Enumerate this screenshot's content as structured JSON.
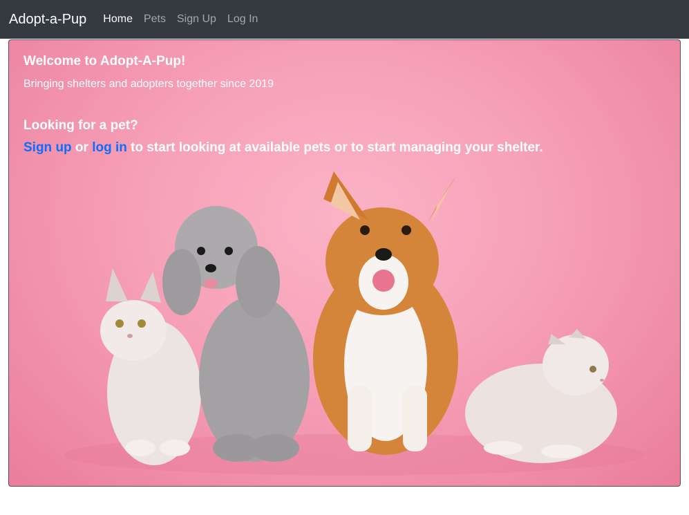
{
  "navbar": {
    "brand": "Adopt-a-Pup",
    "links": [
      {
        "label": "Home",
        "active": true
      },
      {
        "label": "Pets",
        "active": false
      },
      {
        "label": "Sign Up",
        "active": false
      },
      {
        "label": "Log In",
        "active": false
      }
    ],
    "colors": {
      "background": "#343a40",
      "active": "#ffffff",
      "inactive": "#a0a3a6"
    }
  },
  "hero": {
    "title": "Welcome to Adopt-A-Pup!",
    "subtitle": "Bringing shelters and adopters together since 2019",
    "question": "Looking for a pet?",
    "cta": {
      "signup_link": "Sign up",
      "or_text": " or ",
      "login_link": "log in",
      "rest_text": " to start looking at available pets or to start managing your shelter."
    },
    "image_subjects": [
      "cat",
      "poodle",
      "corgi",
      "cat"
    ],
    "colors": {
      "background": "#f7a2b9",
      "link": "#0d6efd",
      "text": "#ffffff"
    }
  }
}
